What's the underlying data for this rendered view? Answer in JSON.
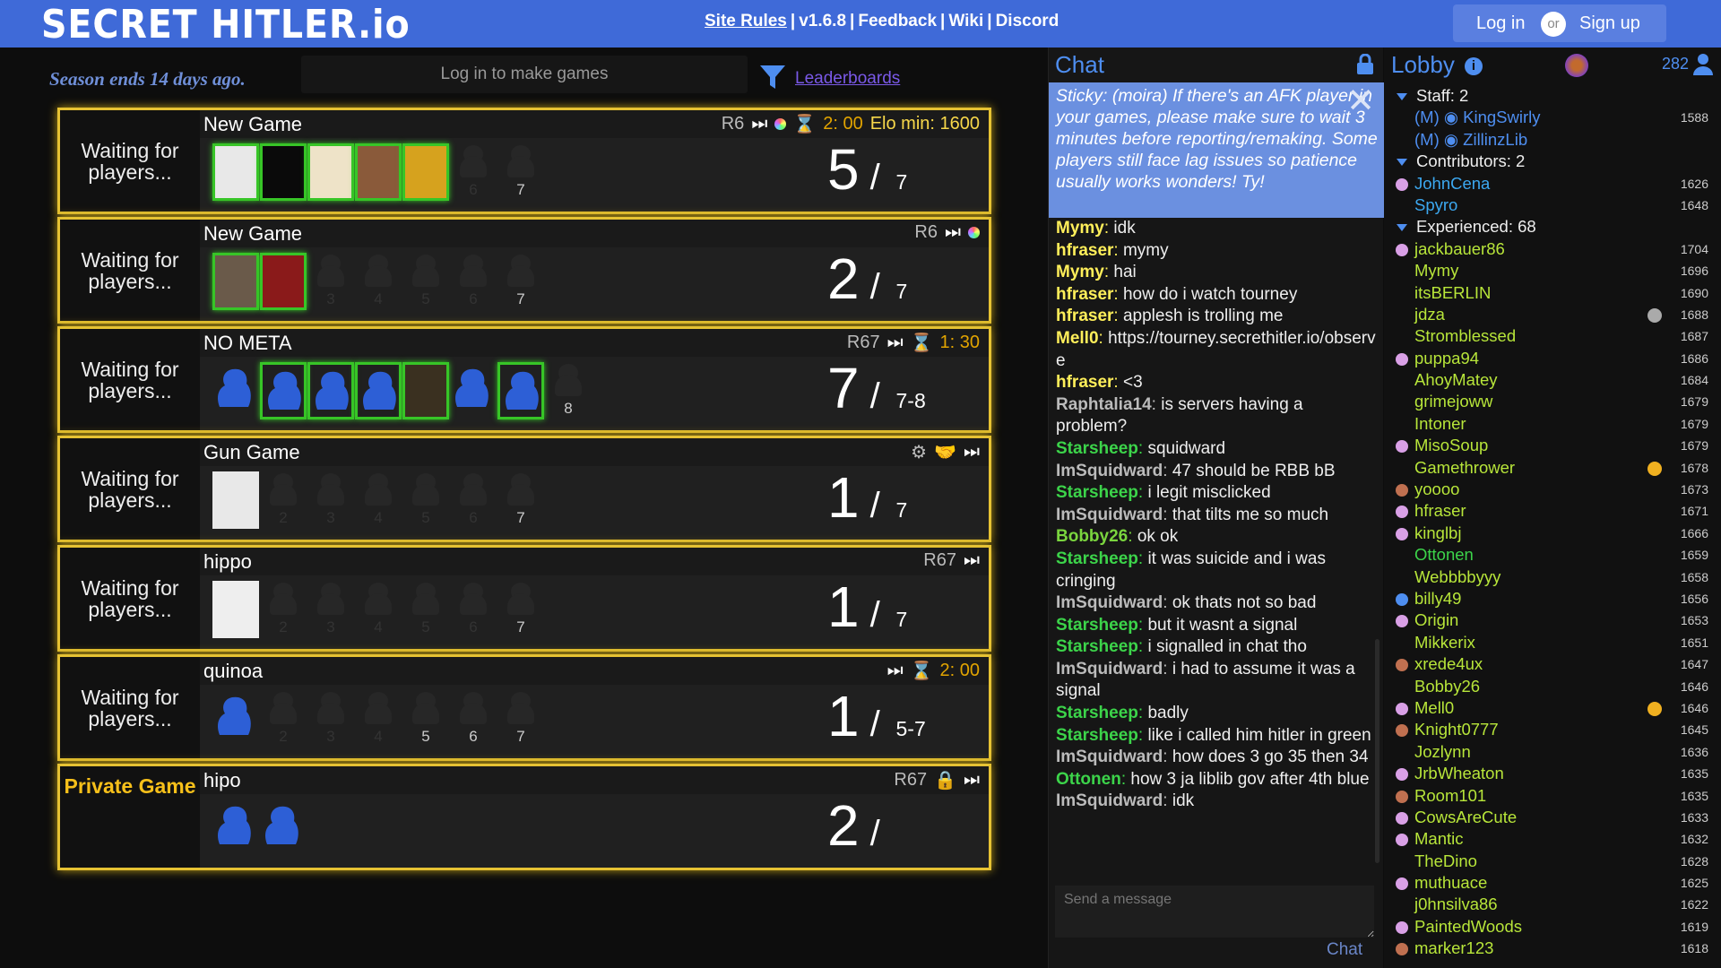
{
  "header": {
    "logo": "SECRET HITLER.io",
    "nav": [
      "Site Rules",
      "v1.6.8",
      "Feedback",
      "Wiki",
      "Discord"
    ],
    "login": "Log in",
    "or": "or",
    "signup": "Sign up"
  },
  "toolbar": {
    "season": "Season ends 14 days ago.",
    "make_games": "Log in to make games",
    "leaderboards": "Leaderboards"
  },
  "colors": {
    "accent": "#3f6ad8",
    "gold": "#e6c233",
    "green": "#37c527",
    "fascist_gold": "#f7c01a"
  },
  "games": [
    {
      "status": "Waiting for players...",
      "name": "New Game",
      "rebalance": "R6",
      "timer": "2: 00",
      "elo": "Elo min: 1600",
      "count": "5",
      "max": "7",
      "slots": [
        "av-tears",
        "av-umbrella",
        "av-pineapple",
        "av-painting",
        "av-yellow",
        "6",
        "7"
      ]
    },
    {
      "status": "Waiting for players...",
      "name": "New Game",
      "rebalance": "R6",
      "timer": "",
      "elo": "",
      "count": "2",
      "max": "7",
      "slots": [
        "av-dark",
        "av-suit",
        "3",
        "4",
        "5",
        "6",
        "7"
      ]
    },
    {
      "status": "Waiting for players...",
      "name": "NO META",
      "rebalance": "R67",
      "timer": "1: 30",
      "elo": "",
      "count": "7",
      "max": "7-8",
      "slots": [
        "blue",
        "blue-g",
        "blue-g",
        "blue-g",
        "av-anime",
        "blue",
        "blue-g",
        "8"
      ]
    },
    {
      "status": "Waiting for players...",
      "name": "Gun Game",
      "rebalance": "",
      "timer": "",
      "elo": "",
      "count": "1",
      "max": "7",
      "slots": [
        "av-meme",
        "2",
        "3",
        "4",
        "5",
        "6",
        "7"
      ]
    },
    {
      "status": "Waiting for players...",
      "name": "hippo",
      "rebalance": "R67",
      "timer": "",
      "elo": "",
      "count": "1",
      "max": "7",
      "slots": [
        "av-man",
        "2",
        "3",
        "4",
        "5",
        "6",
        "7"
      ]
    },
    {
      "status": "Waiting for players...",
      "name": "quinoa",
      "rebalance": "",
      "timer": "2: 00",
      "elo": "",
      "count": "1",
      "max": "5-7",
      "slots": [
        "blue",
        "2",
        "3",
        "4",
        "5",
        "6",
        "7"
      ]
    },
    {
      "status": "Private Game",
      "name": "hipo",
      "rebalance": "R67",
      "timer": "",
      "elo": "",
      "count": "2",
      "max": "",
      "slots": [
        "blue",
        "blue"
      ]
    }
  ],
  "chat": {
    "title": "Chat",
    "sticky": "Sticky: (moira) If there's an AFK player in your games, please make sure to wait 3 minutes before reporting/remaking. Some players still face lag issues so patience usually works wonders! Ty!",
    "messages": [
      {
        "user": "Mymy",
        "text": "idk",
        "color": "#ffef5a"
      },
      {
        "user": "hfraser",
        "text": "mymy",
        "color": "#ffef5a"
      },
      {
        "user": "Mymy",
        "text": "hai",
        "color": "#ffef5a"
      },
      {
        "user": "hfraser",
        "text": "how do i watch tourney",
        "color": "#ffef5a"
      },
      {
        "user": "hfraser",
        "text": "applesh is trolling me",
        "color": "#ffef5a"
      },
      {
        "user": "Mell0",
        "text": "https://tourney.secrethitler.io/observe",
        "color": "#ffef5a"
      },
      {
        "user": "hfraser",
        "text": "<3",
        "color": "#ffef5a"
      },
      {
        "user": "Raphtalia14",
        "text": "is servers having a problem?",
        "color": "#bbbbbb"
      },
      {
        "user": "Starsheep",
        "text": "squidward",
        "color": "#3cd44a"
      },
      {
        "user": "ImSquidward",
        "text": "47 should be RBB bB",
        "color": "#bbbbbb"
      },
      {
        "user": "Starsheep",
        "text": "i legit misclicked",
        "color": "#3cd44a"
      },
      {
        "user": "ImSquidward",
        "text": "that tilts me so much",
        "color": "#bbbbbb"
      },
      {
        "user": "Bobby26",
        "text": "ok ok",
        "color": "#7ad53e"
      },
      {
        "user": "Starsheep",
        "text": "it was suicide and i was cringing",
        "color": "#3cd44a"
      },
      {
        "user": "ImSquidward",
        "text": "ok thats not so bad",
        "color": "#bbbbbb"
      },
      {
        "user": "Starsheep",
        "text": "but it wasnt a signal",
        "color": "#3cd44a"
      },
      {
        "user": "Starsheep",
        "text": "i signalled in chat tho",
        "color": "#3cd44a"
      },
      {
        "user": "ImSquidward",
        "text": "i had to assume it was a signal",
        "color": "#bbbbbb"
      },
      {
        "user": "Starsheep",
        "text": "badly",
        "color": "#3cd44a"
      },
      {
        "user": "Starsheep",
        "text": "like i called him hitler in green",
        "color": "#3cd44a"
      },
      {
        "user": "ImSquidward",
        "text": "how does 3 go 35 then 34",
        "color": "#bbbbbb"
      },
      {
        "user": "Ottonen",
        "text": "how 3 ja liblib gov after 4th blue",
        "color": "#3cd44a"
      },
      {
        "user": "ImSquidward",
        "text": "idk",
        "color": "#bbbbbb"
      }
    ],
    "input_placeholder": "Send a message",
    "send": "Chat"
  },
  "lobby": {
    "title": "Lobby",
    "user_count": "282",
    "groups": [
      {
        "label": "Staff: 2",
        "users": [
          {
            "name": "(M) ◉ KingSwirly",
            "elo": "1588",
            "color": "#4e8ef0",
            "dot": ""
          },
          {
            "name": "(M) ◉ ZillinzLib",
            "elo": "",
            "color": "#4e8ef0",
            "dot": ""
          }
        ]
      },
      {
        "label": "Contributors: 2",
        "users": [
          {
            "name": "JohnCena",
            "elo": "1626",
            "color": "#3ca8f0",
            "dot": "#d9a0e6"
          },
          {
            "name": "Spyro",
            "elo": "1648",
            "color": "#3ca8f0",
            "dot": ""
          }
        ]
      },
      {
        "label": "Experienced: 68",
        "users": [
          {
            "name": "jackbauer86",
            "elo": "1704",
            "color": "#b8e63a",
            "dot": "#d9a0e6"
          },
          {
            "name": "Mymy",
            "elo": "1696",
            "color": "#b8e63a",
            "dot": ""
          },
          {
            "name": "itsBERLIN",
            "elo": "1690",
            "color": "#b8e63a",
            "dot": ""
          },
          {
            "name": "jdza",
            "elo": "1688",
            "color": "#b8e63a",
            "dot": "",
            "badge": "#aaaaaa"
          },
          {
            "name": "Stromblessed",
            "elo": "1687",
            "color": "#b8e63a",
            "dot": ""
          },
          {
            "name": "puppa94",
            "elo": "1686",
            "color": "#b8e63a",
            "dot": "#d9a0e6"
          },
          {
            "name": "AhoyMatey",
            "elo": "1684",
            "color": "#b8e63a",
            "dot": ""
          },
          {
            "name": "grimejoww",
            "elo": "1679",
            "color": "#b8e63a",
            "dot": ""
          },
          {
            "name": "Intoner",
            "elo": "1679",
            "color": "#b8e63a",
            "dot": ""
          },
          {
            "name": "MisoSoup",
            "elo": "1679",
            "color": "#b8e63a",
            "dot": "#d9a0e6"
          },
          {
            "name": "Gamethrower",
            "elo": "1678",
            "color": "#b8e63a",
            "dot": "",
            "badge": "#f0b020"
          },
          {
            "name": "yoooo",
            "elo": "1673",
            "color": "#b8e63a",
            "dot": "#c07050"
          },
          {
            "name": "hfraser",
            "elo": "1671",
            "color": "#b8e63a",
            "dot": "#d9a0e6"
          },
          {
            "name": "kinglbj",
            "elo": "1666",
            "color": "#b8e63a",
            "dot": "#d9a0e6"
          },
          {
            "name": "Ottonen",
            "elo": "1659",
            "color": "#3cd44a",
            "dot": ""
          },
          {
            "name": "Webbbbyyy",
            "elo": "1658",
            "color": "#b8e63a",
            "dot": ""
          },
          {
            "name": "billy49",
            "elo": "1656",
            "color": "#b8e63a",
            "dot": "#4e8ef0"
          },
          {
            "name": "Origin",
            "elo": "1653",
            "color": "#b8e63a",
            "dot": "#d9a0e6"
          },
          {
            "name": "Mikkerix",
            "elo": "1651",
            "color": "#b8e63a",
            "dot": ""
          },
          {
            "name": "xrede4ux",
            "elo": "1647",
            "color": "#b8e63a",
            "dot": "#c07050"
          },
          {
            "name": "Bobby26",
            "elo": "1646",
            "color": "#b8e63a",
            "dot": ""
          },
          {
            "name": "Mell0",
            "elo": "1646",
            "color": "#b8e63a",
            "dot": "#d9a0e6",
            "badge": "#f0b020"
          },
          {
            "name": "Knight0777",
            "elo": "1645",
            "color": "#b8e63a",
            "dot": "#c07050"
          },
          {
            "name": "Jozlynn",
            "elo": "1636",
            "color": "#b8e63a",
            "dot": ""
          },
          {
            "name": "JrbWheaton",
            "elo": "1635",
            "color": "#b8e63a",
            "dot": "#d9a0e6"
          },
          {
            "name": "Room101",
            "elo": "1635",
            "color": "#b8e63a",
            "dot": "#c07050"
          },
          {
            "name": "CowsAreCute",
            "elo": "1633",
            "color": "#b8e63a",
            "dot": "#d9a0e6"
          },
          {
            "name": "Mantic",
            "elo": "1632",
            "color": "#b8e63a",
            "dot": "#d9a0e6"
          },
          {
            "name": "TheDino",
            "elo": "1628",
            "color": "#b8e63a",
            "dot": ""
          },
          {
            "name": "muthuace",
            "elo": "1625",
            "color": "#b8e63a",
            "dot": "#d9a0e6"
          },
          {
            "name": "j0hnsilva86",
            "elo": "1622",
            "color": "#b8e63a",
            "dot": ""
          },
          {
            "name": "PaintedWoods",
            "elo": "1619",
            "color": "#b8e63a",
            "dot": "#d9a0e6"
          },
          {
            "name": "marker123",
            "elo": "1618",
            "color": "#b8e63a",
            "dot": "#c07050"
          }
        ]
      }
    ]
  }
}
